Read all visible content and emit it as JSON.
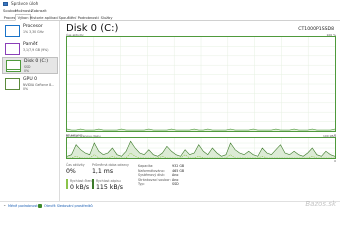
{
  "window": {
    "title": "Správce úloh"
  },
  "menu": [
    "Soubor",
    "Možnosti",
    "Zobrazit"
  ],
  "tabs": [
    "Procesy",
    "Výkon",
    "Historie aplikací",
    "Spouštění",
    "Podrobnosti",
    "Služby"
  ],
  "active_tab_index": 1,
  "sidebar": {
    "items": [
      {
        "name": "Procesor",
        "sub": "1% 3,30 GHz",
        "color": "#1a73c8"
      },
      {
        "name": "Paměť",
        "sub": "3,1/7,9 GB (9%)",
        "color": "#8a3fb8"
      },
      {
        "name": "Disk 0 (C:)",
        "sub": "SSD\n0%",
        "color": "#4f9a3c"
      },
      {
        "name": "GPU 0",
        "sub": "NVIDIA GeForce 8...\n0%",
        "color": "#5c8a3c"
      }
    ],
    "selected_index": 2
  },
  "disk": {
    "title": "Disk 0 (C:)",
    "model": "CT1000P1SSD8",
    "activity_label": "Čas aktivity",
    "activity_max": "100 %",
    "sixty_seconds": "60 sekund",
    "zero": "0",
    "transfer_label": "Rychlost přenosu disku",
    "transfer_max": "100 kB/s"
  },
  "stats": {
    "active_time_label": "Čas aktivity",
    "active_time_value": "0%",
    "avg_response_label": "Průměrná doba odezvy",
    "avg_response_value": "1,1 ms",
    "read_label": "Rychlost čtení",
    "read_value": "0 kB/s",
    "write_label": "Rychlost zápisu",
    "write_value": "115 kB/s"
  },
  "details": [
    {
      "label": "Kapacita:",
      "value": "932 GB"
    },
    {
      "label": "Naformátováno:",
      "value": "465 GB"
    },
    {
      "label": "Systémový disk:",
      "value": "Ano"
    },
    {
      "label": "Stránkovací soubor:",
      "value": "Ano"
    },
    {
      "label": "Typ:",
      "value": "SSD"
    }
  ],
  "footer": {
    "less_details": "Méně podrobností",
    "open_monitor": "Otevřít Sledování prostředků"
  },
  "watermark": "Bazos.sk",
  "colors": {
    "disk": "#4f9a3c",
    "cpu": "#1a73c8",
    "memory": "#8a3fb8",
    "read_line": "#8bc34a",
    "write_line": "#3c7a2a"
  },
  "activity_series": [
    2,
    1,
    1,
    2,
    1,
    1,
    1,
    2,
    1,
    1,
    1,
    1,
    2,
    1,
    1,
    1,
    1,
    1,
    2,
    1,
    1,
    1,
    1,
    2,
    1,
    1,
    1,
    1,
    2,
    1,
    1,
    2,
    1,
    1,
    1,
    1,
    2,
    1,
    1,
    1,
    1,
    2,
    1,
    1,
    1,
    1,
    2,
    1,
    1,
    1,
    2,
    1,
    1,
    1,
    2,
    1,
    1,
    1,
    1,
    2
  ],
  "write_series": [
    1,
    2,
    8,
    5,
    3,
    2,
    9,
    4,
    2,
    3,
    6,
    2,
    1,
    4,
    10,
    6,
    3,
    2,
    5,
    2,
    1,
    3,
    7,
    4,
    2,
    1,
    5,
    2,
    3,
    8,
    4,
    2,
    6,
    3,
    1,
    2,
    9,
    5,
    3,
    2,
    4,
    2,
    1,
    6,
    3,
    2,
    5,
    8,
    3,
    2,
    4,
    2,
    1,
    3,
    6,
    2,
    1,
    4,
    2,
    1
  ],
  "read_series": [
    0,
    0,
    1,
    0,
    0,
    0,
    2,
    0,
    0,
    0,
    1,
    0,
    0,
    0,
    3,
    1,
    0,
    0,
    0,
    0,
    0,
    1,
    0,
    0,
    0,
    0,
    2,
    0,
    0,
    1,
    0,
    0,
    0,
    0,
    0,
    0,
    2,
    0,
    0,
    0,
    0,
    0,
    0,
    1,
    0,
    0,
    0,
    0,
    0,
    0,
    0,
    0,
    0,
    0,
    1,
    0,
    0,
    0,
    0,
    0
  ]
}
